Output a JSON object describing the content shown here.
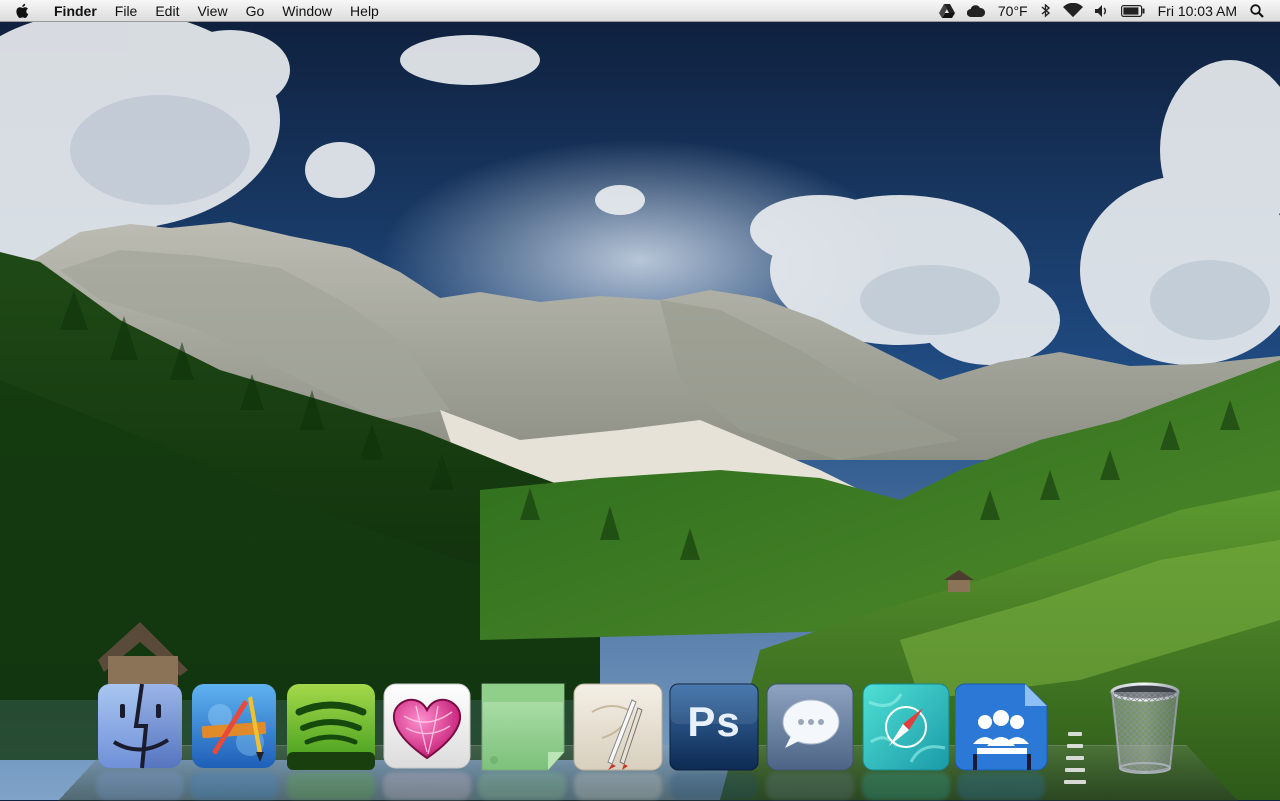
{
  "menubar": {
    "apple_icon": "apple-logo-icon",
    "app_name": "Finder",
    "menus": [
      "File",
      "Edit",
      "View",
      "Go",
      "Window",
      "Help"
    ],
    "status": {
      "drive_icon": "google-drive-icon",
      "weather_icon": "cloud-icon",
      "temperature": "70°F",
      "bluetooth_icon": "bluetooth-icon",
      "wifi_icon": "wifi-icon",
      "volume_icon": "speaker-icon",
      "battery_icon": "battery-icon",
      "clock": "Fri 10:03 AM",
      "spotlight_icon": "magnifier-icon"
    }
  },
  "dock": {
    "items": [
      {
        "name": "finder",
        "icon": "finder-face-icon"
      },
      {
        "name": "app-store",
        "icon": "pencil-ruler-icon"
      },
      {
        "name": "spotify",
        "icon": "spotify-icon"
      },
      {
        "name": "love-app",
        "icon": "pink-heart-icon"
      },
      {
        "name": "stickies",
        "icon": "sticky-note-icon"
      },
      {
        "name": "sketch-app",
        "icon": "paint-brush-icon"
      },
      {
        "name": "photoshop",
        "icon": "photoshop-icon",
        "label": "Ps"
      },
      {
        "name": "messages",
        "icon": "speech-bubble-icon"
      },
      {
        "name": "safari",
        "icon": "compass-icon"
      },
      {
        "name": "contacts",
        "icon": "people-group-icon"
      }
    ],
    "trash_icon": "trash-can-icon"
  },
  "colors": {
    "menubar_top": "#f7f7f7",
    "menubar_bottom": "#dcdcdc",
    "sky": "#14305a",
    "forest": "#2f6a1e"
  }
}
